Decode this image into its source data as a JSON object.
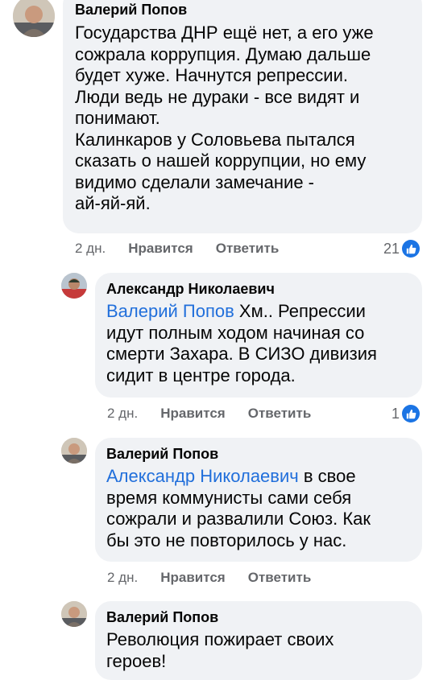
{
  "comments": [
    {
      "author": "Валерий Попов",
      "lines": [
        "Государства ДНР ещё нет, а его уже",
        "сожрала коррупция. Думаю дальше",
        "будет хуже. Начнутся репрессии.",
        "Люди ведь не дураки - все видят и",
        "понимают.",
        "Калинкаров у Соловьева пытался",
        "сказать о нашей коррупции, но ему",
        "видимо сделали замечание -",
        "ай-яй-яй."
      ],
      "time": "2 дн.",
      "like_label": "Нравится",
      "reply_label": "Ответить",
      "reactions": "21"
    },
    {
      "author": "Александр Николаевич",
      "mention": "Валерий Попов",
      "first_line_rest": " Хм.. Репрессии",
      "lines": [
        "идут полным ходом начиная со",
        "смерти Захара. В СИЗО дивизия",
        "сидит в центре города."
      ],
      "time": "2 дн.",
      "like_label": "Нравится",
      "reply_label": "Ответить",
      "reactions": "1"
    },
    {
      "author": "Валерий Попов",
      "mention": "Александр Николаевич",
      "first_line_rest": " в свое",
      "lines": [
        "время коммунисты сами себя",
        "сожрали и развалили Союз. Как",
        "бы это не повторилось у нас."
      ],
      "time": "2 дн.",
      "like_label": "Нравится",
      "reply_label": "Ответить"
    },
    {
      "author": "Валерий Попов",
      "lines": [
        "Революция пожирает своих",
        "героев!"
      ]
    }
  ],
  "colors": {
    "bubble": "#f0f2f5",
    "mention": "#216fdb",
    "meta": "#65676b",
    "like_badge": "#1b74e4"
  },
  "icons": {
    "avatar": "user-photo",
    "reaction": "thumbs-up-icon"
  }
}
